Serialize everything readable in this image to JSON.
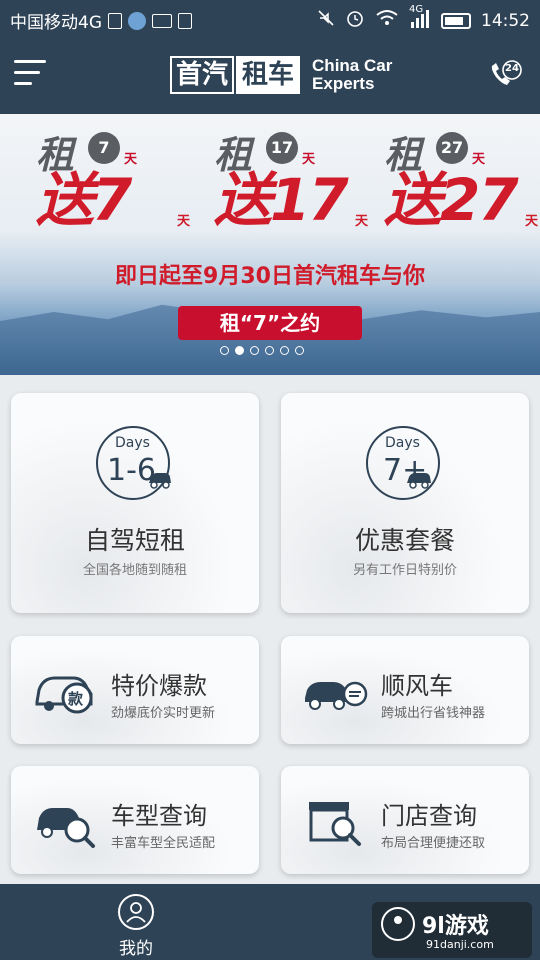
{
  "status": {
    "carrier": "中国移动4G",
    "network": "4G",
    "time": "14:52"
  },
  "header": {
    "logo_cn_1": "首汽",
    "logo_cn_2": "租车",
    "logo_en_1": "China Car",
    "logo_en_2": "Experts",
    "hotline_badge": "24"
  },
  "banner": {
    "promos": [
      {
        "zu": "租",
        "days": "7",
        "tian": "天",
        "song": "送7"
      },
      {
        "zu": "租",
        "days": "17",
        "tian": "天",
        "song": "送17"
      },
      {
        "zu": "租",
        "days": "27",
        "tian": "天",
        "song": "送27"
      }
    ],
    "headline": "即日起至9月30日首汽租车与你",
    "tag": "租“7”之约",
    "active_slide": 2,
    "slide_count": 6
  },
  "services": {
    "self_drive": {
      "days_label": "Days",
      "days_range": "1-6",
      "title": "自驾短租",
      "subtitle": "全国各地随到随租"
    },
    "package": {
      "days_label": "Days",
      "days_range": "7+",
      "title": "优惠套餐",
      "subtitle": "另有工作日特别价"
    },
    "special": {
      "title": "特价爆款",
      "subtitle": "劲爆底价实时更新",
      "badge": "款"
    },
    "ride": {
      "title": "顺风车",
      "subtitle": "跨城出行省钱神器"
    },
    "models": {
      "title": "车型查询",
      "subtitle": "丰富车型全民适配"
    },
    "stores": {
      "title": "门店查询",
      "subtitle": "布局合理便捷还取"
    }
  },
  "bottom": {
    "mine_label": "我的"
  },
  "watermark": {
    "brand": "9l游戏",
    "domain": "91danji.com"
  },
  "colors": {
    "nav": "#2f4356",
    "promo_red": "#d01c2a"
  }
}
